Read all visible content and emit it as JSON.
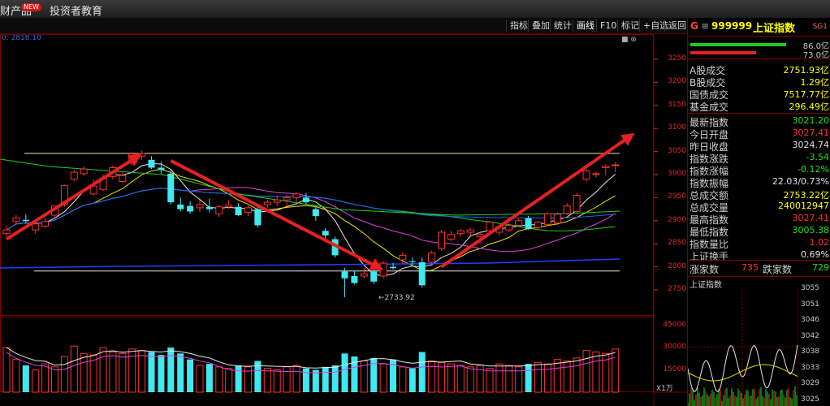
{
  "menu": {
    "item1": "财产品",
    "badge": "NEW",
    "item2": "投资者教育"
  },
  "toolbar": {
    "buttons": [
      "指标",
      "叠加",
      "统计",
      "画线",
      "F10",
      "标记",
      "+自选",
      "返回"
    ],
    "active": "画线"
  },
  "chart": {
    "caption": "0: 2818.10",
    "low_marker": "←2733.92",
    "window_icons": "■ ⊗",
    "vol_unit_label": "X1万"
  },
  "chart_data": {
    "type": "candlestick",
    "price_axis": {
      "ticks": [
        3250,
        3200,
        3150,
        3100,
        3050,
        3000,
        2950,
        2900,
        2850,
        2800,
        2750
      ],
      "range": [
        2718,
        3277
      ]
    },
    "volume_axis": {
      "ticks": [
        45000,
        30000,
        15000
      ],
      "range": [
        0,
        48000
      ]
    },
    "low_label": 2733.92,
    "horizontal_lines": [
      3046,
      2791
    ],
    "arrows": [
      {
        "from_price": 2860,
        "to_price": 3045,
        "from_bar": 0,
        "to_bar": 13
      },
      {
        "from_price": 3030,
        "to_price": 2793,
        "from_bar": 17,
        "to_bar": 38
      },
      {
        "from_price": 2800,
        "to_price": 3090,
        "from_bar": 45,
        "to_bar": 64
      }
    ],
    "candles": [
      {
        "o": 2872,
        "h": 2890,
        "l": 2866,
        "c": 2880
      },
      {
        "o": 2898,
        "h": 2912,
        "l": 2893,
        "c": 2906
      },
      {
        "o": 2902,
        "h": 2914,
        "l": 2895,
        "c": 2899
      },
      {
        "o": 2880,
        "h": 2895,
        "l": 2872,
        "c": 2893
      },
      {
        "o": 2888,
        "h": 2905,
        "l": 2884,
        "c": 2898
      },
      {
        "o": 2912,
        "h": 2930,
        "l": 2908,
        "c": 2932
      },
      {
        "o": 2935,
        "h": 2978,
        "l": 2930,
        "c": 2976
      },
      {
        "o": 2990,
        "h": 3010,
        "l": 2985,
        "c": 3005
      },
      {
        "o": 3002,
        "h": 3018,
        "l": 2998,
        "c": 3012
      },
      {
        "o": 2958,
        "h": 2990,
        "l": 2955,
        "c": 2975
      },
      {
        "o": 2968,
        "h": 3000,
        "l": 2964,
        "c": 2992
      },
      {
        "o": 2996,
        "h": 3020,
        "l": 2990,
        "c": 3015
      },
      {
        "o": 2985,
        "h": 3005,
        "l": 2982,
        "c": 2998
      },
      {
        "o": 3025,
        "h": 3048,
        "l": 3020,
        "c": 3045
      },
      {
        "o": 3040,
        "h": 3052,
        "l": 3032,
        "c": 3046
      },
      {
        "o": 3032,
        "h": 3040,
        "l": 3012,
        "c": 3015
      },
      {
        "o": 3015,
        "h": 3028,
        "l": 3002,
        "c": 3010
      },
      {
        "o": 3002,
        "h": 3010,
        "l": 2935,
        "c": 2940
      },
      {
        "o": 2935,
        "h": 2950,
        "l": 2920,
        "c": 2925
      },
      {
        "o": 2932,
        "h": 2942,
        "l": 2915,
        "c": 2920
      },
      {
        "o": 2928,
        "h": 2945,
        "l": 2920,
        "c": 2935
      },
      {
        "o": 2930,
        "h": 2948,
        "l": 2918,
        "c": 2925
      },
      {
        "o": 2915,
        "h": 2935,
        "l": 2908,
        "c": 2930
      },
      {
        "o": 2930,
        "h": 2945,
        "l": 2925,
        "c": 2934
      },
      {
        "o": 2930,
        "h": 2938,
        "l": 2910,
        "c": 2912
      },
      {
        "o": 2918,
        "h": 2932,
        "l": 2910,
        "c": 2928
      },
      {
        "o": 2925,
        "h": 2935,
        "l": 2885,
        "c": 2890
      },
      {
        "o": 2935,
        "h": 2945,
        "l": 2928,
        "c": 2940
      },
      {
        "o": 2940,
        "h": 2955,
        "l": 2932,
        "c": 2945
      },
      {
        "o": 2945,
        "h": 2955,
        "l": 2930,
        "c": 2950
      },
      {
        "o": 2950,
        "h": 2962,
        "l": 2940,
        "c": 2958
      },
      {
        "o": 2950,
        "h": 2960,
        "l": 2935,
        "c": 2940
      },
      {
        "o": 2925,
        "h": 2932,
        "l": 2900,
        "c": 2910
      },
      {
        "o": 2878,
        "h": 2884,
        "l": 2862,
        "c": 2868
      },
      {
        "o": 2860,
        "h": 2865,
        "l": 2820,
        "c": 2825
      },
      {
        "o": 2790,
        "h": 2798,
        "l": 2734,
        "c": 2775
      },
      {
        "o": 2780,
        "h": 2792,
        "l": 2762,
        "c": 2765
      },
      {
        "o": 2780,
        "h": 2797,
        "l": 2775,
        "c": 2785
      },
      {
        "o": 2790,
        "h": 2805,
        "l": 2763,
        "c": 2768
      },
      {
        "o": 2780,
        "h": 2812,
        "l": 2775,
        "c": 2808
      },
      {
        "o": 2800,
        "h": 2808,
        "l": 2794,
        "c": 2797
      },
      {
        "o": 2815,
        "h": 2832,
        "l": 2807,
        "c": 2825
      },
      {
        "o": 2812,
        "h": 2820,
        "l": 2804,
        "c": 2810
      },
      {
        "o": 2810,
        "h": 2820,
        "l": 2755,
        "c": 2760
      },
      {
        "o": 2810,
        "h": 2835,
        "l": 2805,
        "c": 2830
      },
      {
        "o": 2840,
        "h": 2880,
        "l": 2835,
        "c": 2875
      },
      {
        "o": 2860,
        "h": 2878,
        "l": 2855,
        "c": 2870
      },
      {
        "o": 2872,
        "h": 2882,
        "l": 2866,
        "c": 2878
      },
      {
        "o": 2875,
        "h": 2885,
        "l": 2868,
        "c": 2880
      },
      {
        "o": 2865,
        "h": 2875,
        "l": 2850,
        "c": 2870
      },
      {
        "o": 2878,
        "h": 2900,
        "l": 2875,
        "c": 2897
      },
      {
        "o": 2875,
        "h": 2892,
        "l": 2868,
        "c": 2887
      },
      {
        "o": 2880,
        "h": 2895,
        "l": 2875,
        "c": 2890
      },
      {
        "o": 2890,
        "h": 2905,
        "l": 2888,
        "c": 2900
      },
      {
        "o": 2905,
        "h": 2910,
        "l": 2880,
        "c": 2882
      },
      {
        "o": 2885,
        "h": 2900,
        "l": 2880,
        "c": 2897
      },
      {
        "o": 2892,
        "h": 2918,
        "l": 2888,
        "c": 2915
      },
      {
        "o": 2895,
        "h": 2918,
        "l": 2890,
        "c": 2914
      },
      {
        "o": 2915,
        "h": 2938,
        "l": 2912,
        "c": 2932
      },
      {
        "o": 2920,
        "h": 2960,
        "l": 2915,
        "c": 2955
      },
      {
        "o": 2990,
        "h": 3012,
        "l": 2985,
        "c": 3008
      },
      {
        "o": 3000,
        "h": 3006,
        "l": 2994,
        "c": 3002
      },
      {
        "o": 3015,
        "h": 3022,
        "l": 2998,
        "c": 3018
      },
      {
        "o": 3020,
        "h": 3027,
        "l": 3005,
        "c": 3021
      }
    ],
    "volumes": [
      30000,
      22000,
      18000,
      15000,
      19000,
      17000,
      24000,
      31000,
      26000,
      25000,
      30000,
      27000,
      26000,
      29000,
      28000,
      27000,
      25000,
      30000,
      26000,
      22000,
      18000,
      19000,
      17000,
      16000,
      18000,
      17000,
      21000,
      16000,
      15000,
      17000,
      18000,
      16000,
      15000,
      17000,
      18000,
      26000,
      24000,
      21000,
      23000,
      19000,
      22000,
      17000,
      16000,
      27000,
      21000,
      20000,
      19000,
      18000,
      17000,
      18000,
      16000,
      19000,
      18000,
      17000,
      19000,
      20000,
      19000,
      22000,
      21000,
      23000,
      28000,
      27000,
      26000,
      29000
    ]
  },
  "quote": {
    "flag": "G",
    "eq": "≡",
    "code": "999999",
    "name": "上证指数",
    "suffix": "SG1",
    "strength_up": "86.0亿",
    "strength_down": "73.0亿",
    "up_fraction": 0.86,
    "down_fraction": 0.73,
    "turnover_rows": [
      {
        "label": "A股成交",
        "value": "2751.93亿"
      },
      {
        "label": "B股成交",
        "value": "1.29亿"
      },
      {
        "label": "国债成交",
        "value": "7517.77亿"
      },
      {
        "label": "基金成交",
        "value": "296.49亿"
      }
    ],
    "detail_rows": [
      {
        "label": "最新指数",
        "value": "3021.20",
        "color": "#1ee01e"
      },
      {
        "label": "今日开盘",
        "value": "3027.41",
        "color": "#ff3030"
      },
      {
        "label": "昨日收盘",
        "value": "3024.74",
        "color": "#e0e0e0"
      },
      {
        "label": "指数涨跌",
        "value": "-3.54",
        "color": "#1ee01e"
      },
      {
        "label": "指数涨幅",
        "value": "-0.12%",
        "color": "#1ee01e"
      },
      {
        "label": "指数振幅",
        "value": "22.03/0.73%",
        "color": "#e0e0e0"
      },
      {
        "label": "总成交额",
        "value": "2753.22亿",
        "color": "#ffff00"
      },
      {
        "label": "总成交量",
        "value": "240012947",
        "color": "#ffff00"
      },
      {
        "label": "最高指数",
        "value": "3027.41",
        "color": "#ff3030"
      },
      {
        "label": "最低指数",
        "value": "3005.38",
        "color": "#1ee01e"
      },
      {
        "label": "指数量比",
        "value": "1.02",
        "color": "#ff3030"
      },
      {
        "label": "上证换手",
        "value": "0.69%",
        "color": "#e0e0e0"
      }
    ],
    "rise_label": "涨家数",
    "rise_count": "735",
    "fall_label": "跌家数",
    "fall_count": "729",
    "mini_title": "上证指数",
    "mini_axis": [
      "3055",
      "3051",
      "3046",
      "3042",
      "3038",
      "3033",
      "3029",
      "3025"
    ]
  }
}
